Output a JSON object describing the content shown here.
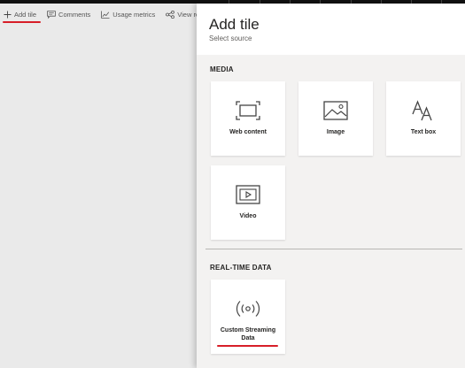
{
  "toolbar": {
    "items": [
      {
        "label": "Add tile",
        "icon": "plus-icon"
      },
      {
        "label": "Comments",
        "icon": "comment-icon"
      },
      {
        "label": "Usage metrics",
        "icon": "chart-icon"
      },
      {
        "label": "View rela",
        "icon": "share-icon"
      }
    ]
  },
  "pane": {
    "title": "Add tile",
    "subtitle": "Select source",
    "sections": {
      "media": {
        "label": "MEDIA",
        "tiles": [
          {
            "label": "Web content",
            "icon": "web-content-icon"
          },
          {
            "label": "Image",
            "icon": "image-icon"
          },
          {
            "label": "Text box",
            "icon": "text-box-icon"
          },
          {
            "label": "Video",
            "icon": "video-icon"
          }
        ]
      },
      "realtime": {
        "label": "REAL-TIME DATA",
        "tiles": [
          {
            "label": "Custom Streaming Data",
            "icon": "streaming-icon"
          }
        ]
      }
    }
  },
  "colors": {
    "accent_underline": "#d71e28",
    "pane_background": "#f3f2f1",
    "canvas_background": "#eaeaea",
    "top_strip": "#111111"
  }
}
